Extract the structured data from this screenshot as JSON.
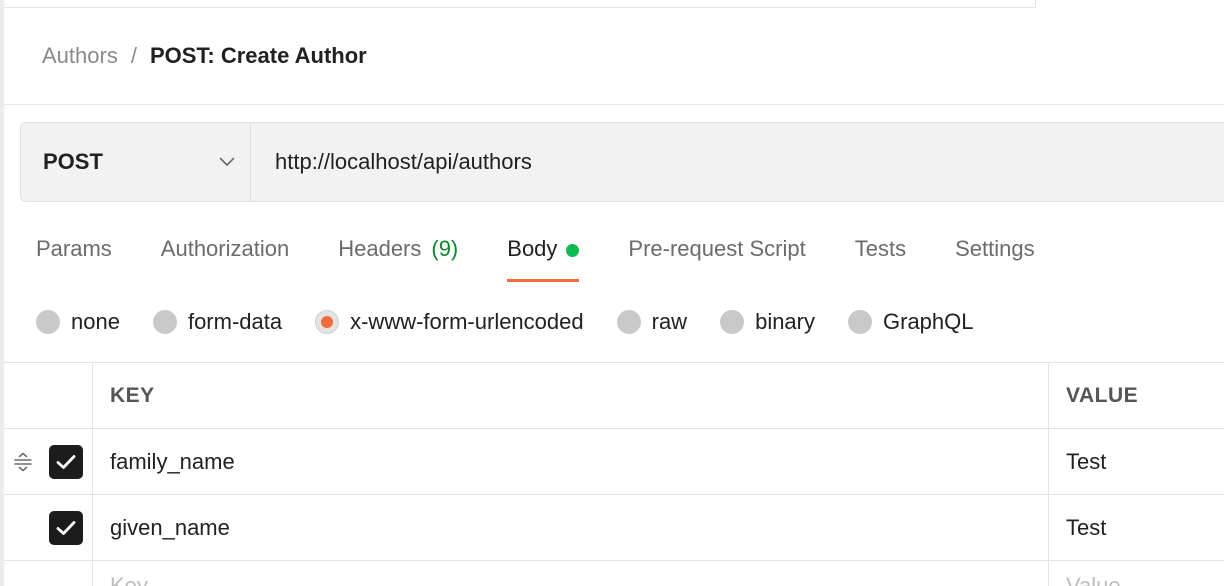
{
  "breadcrumb": {
    "parent": "Authors",
    "separator": "/",
    "current": "POST: Create Author"
  },
  "request": {
    "method": "POST",
    "url": "http://localhost/api/authors",
    "method_dropdown_icon": "chevron-down-icon"
  },
  "tabs": [
    {
      "label": "Params"
    },
    {
      "label": "Authorization"
    },
    {
      "label": "Headers",
      "count": "(9)"
    },
    {
      "label": "Body",
      "active": true,
      "indicator": "green-dot"
    },
    {
      "label": "Pre-request Script"
    },
    {
      "label": "Tests"
    },
    {
      "label": "Settings"
    }
  ],
  "body_types": [
    {
      "label": "none"
    },
    {
      "label": "form-data"
    },
    {
      "label": "x-www-form-urlencoded",
      "selected": true
    },
    {
      "label": "raw"
    },
    {
      "label": "binary"
    },
    {
      "label": "GraphQL"
    }
  ],
  "table": {
    "headers": {
      "key": "KEY",
      "value": "VALUE"
    },
    "rows": [
      {
        "checked": true,
        "key": "family_name",
        "value": "Test"
      },
      {
        "checked": true,
        "key": "given_name",
        "value": "Test"
      }
    ],
    "new_row": {
      "key_placeholder": "Key",
      "value_placeholder": "Value"
    }
  },
  "colors": {
    "accent": "#f26b3a",
    "active_dot": "#0cbb52",
    "count_green": "#0a8a2c",
    "checkbox": "#1c1c1c"
  }
}
